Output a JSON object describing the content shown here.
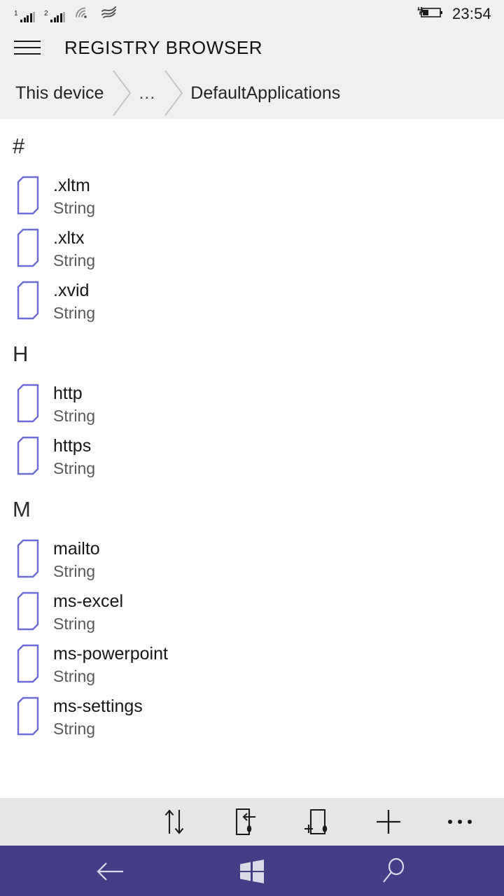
{
  "status_bar": {
    "sim1_label": "1",
    "sim2_label": "2",
    "wifi_icon": "wifi-icon",
    "data_icon": "cellular-data-icon",
    "battery_icon": "battery-charging-icon",
    "time": "23:54"
  },
  "title_bar": {
    "menu_icon": "hamburger-menu-icon",
    "title": "REGISTRY BROWSER"
  },
  "breadcrumb": {
    "items": [
      {
        "label": "This device"
      },
      {
        "label": "..."
      },
      {
        "label": "DefaultApplications"
      }
    ]
  },
  "list": {
    "sections": [
      {
        "letter": "#",
        "items": [
          {
            "name": ".xltm",
            "type": "String",
            "icon": "registry-value-icon"
          },
          {
            "name": ".xltx",
            "type": "String",
            "icon": "registry-value-icon"
          },
          {
            "name": ".xvid",
            "type": "String",
            "icon": "registry-value-icon"
          }
        ]
      },
      {
        "letter": "H",
        "items": [
          {
            "name": "http",
            "type": "String",
            "icon": "registry-value-icon"
          },
          {
            "name": "https",
            "type": "String",
            "icon": "registry-value-icon"
          }
        ]
      },
      {
        "letter": "M",
        "items": [
          {
            "name": "mailto",
            "type": "String",
            "icon": "registry-value-icon"
          },
          {
            "name": "ms-excel",
            "type": "String",
            "icon": "registry-value-icon"
          },
          {
            "name": "ms-powerpoint",
            "type": "String",
            "icon": "registry-value-icon"
          },
          {
            "name": "ms-settings",
            "type": "String",
            "icon": "registry-value-icon"
          }
        ]
      }
    ]
  },
  "app_bar": {
    "buttons": [
      {
        "name": "sort-button",
        "icon": "sort-icon"
      },
      {
        "name": "import-button",
        "icon": "import-document-icon"
      },
      {
        "name": "new-value-button",
        "icon": "new-document-icon"
      },
      {
        "name": "add-button",
        "icon": "plus-icon"
      },
      {
        "name": "more-button",
        "icon": "ellipsis-icon"
      }
    ]
  },
  "nav_bar": {
    "back_icon": "back-arrow-icon",
    "home_icon": "windows-start-icon",
    "search_icon": "search-icon"
  },
  "colors": {
    "accent": "#443c85",
    "icon_outline": "#6b6bd6",
    "header_bg": "#f0f0f0",
    "appbar_bg": "#e6e6e6",
    "content_bg": "#ffffff"
  }
}
